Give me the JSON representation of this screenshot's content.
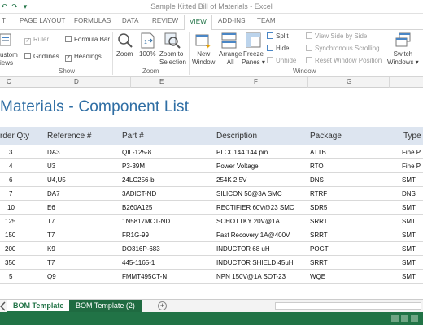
{
  "app": {
    "title": "Sample Kitted Bill of Materials - Excel",
    "qat": [
      "↶",
      "↷",
      "▾"
    ]
  },
  "ribbon_tabs": [
    "T",
    "PAGE LAYOUT",
    "FORMULAS",
    "DATA",
    "REVIEW",
    "VIEW",
    "ADD-INS",
    "TEAM"
  ],
  "active_tab": "VIEW",
  "ribbon": {
    "custom_views": "ustom\niews",
    "ruler": "Ruler",
    "formula_bar": "Formula Bar",
    "gridlines": "Gridlines",
    "headings": "Headings",
    "group_show": "Show",
    "zoom": "Zoom",
    "zoom_100": "100%",
    "zoom_selection_1": "Zoom to",
    "zoom_selection_2": "Selection",
    "group_zoom": "Zoom",
    "new_window_1": "New",
    "new_window_2": "Window",
    "arrange_all_1": "Arrange",
    "arrange_all_2": "All",
    "freeze_panes_1": "Freeze",
    "freeze_panes_2": "Panes ▾",
    "split": "Split",
    "hide": "Hide",
    "unhide": "Unhide",
    "view_side_by_side": "View Side by Side",
    "sync_scrolling": "Synchronous Scrolling",
    "reset_window_position": "Reset Window Position",
    "group_window": "Window",
    "switch_windows_1": "Switch",
    "switch_windows_2": "Windows ▾"
  },
  "column_headers": [
    "C",
    "D",
    "E",
    "F",
    "G"
  ],
  "sheet": {
    "title": "Materials - Component List",
    "headers": [
      "rder Qty",
      "Reference #",
      "Part #",
      "Description",
      "Package",
      "Type"
    ],
    "rows": [
      [
        "3",
        "DA3",
        "QIL-125-8",
        "PLCC144 144 pin",
        "ATTB",
        "Fine P"
      ],
      [
        "4",
        "U3",
        "P3-39M",
        "Power Voltage",
        "RTO",
        "Fine P"
      ],
      [
        "6",
        "U4,U5",
        "24LC256-b",
        "254K 2.5V",
        "DNS",
        "SMT"
      ],
      [
        "7",
        "DA7",
        "3ADICT-ND",
        "SILICON 50@3A SMC",
        "RTRF",
        "DNS"
      ],
      [
        "10",
        "E6",
        "B260A125",
        "RECTIFIER 60V@23 SMC",
        "SDR5",
        "SMT"
      ],
      [
        "125",
        "T7",
        "1N5817MCT-ND",
        "SCHOTTKY 20V@1A",
        "SRRT",
        "SMT"
      ],
      [
        "150",
        "T7",
        "FR1G-99",
        "Fast Recovery 1A@400V",
        "SRRT",
        "SMT"
      ],
      [
        "200",
        "K9",
        "DO316P-683",
        "INDUCTOR 68 uH",
        "POGT",
        "SMT"
      ],
      [
        "350",
        "T7",
        "445-1165-1",
        "INDUCTOR SHIELD 45uH",
        "SRRT",
        "SMT"
      ],
      [
        "5",
        "Q9",
        "FMMT495CT-N",
        "NPN 150V@1A SOT-23",
        "WQE",
        "SMT"
      ]
    ]
  },
  "sheet_tabs": [
    "BOM Template",
    "BOM Template (2)"
  ],
  "add_sheet": "+",
  "colors": {
    "excel_green": "#217346",
    "title_blue": "#2f6ea4",
    "header_fill": "#dde5f0"
  }
}
